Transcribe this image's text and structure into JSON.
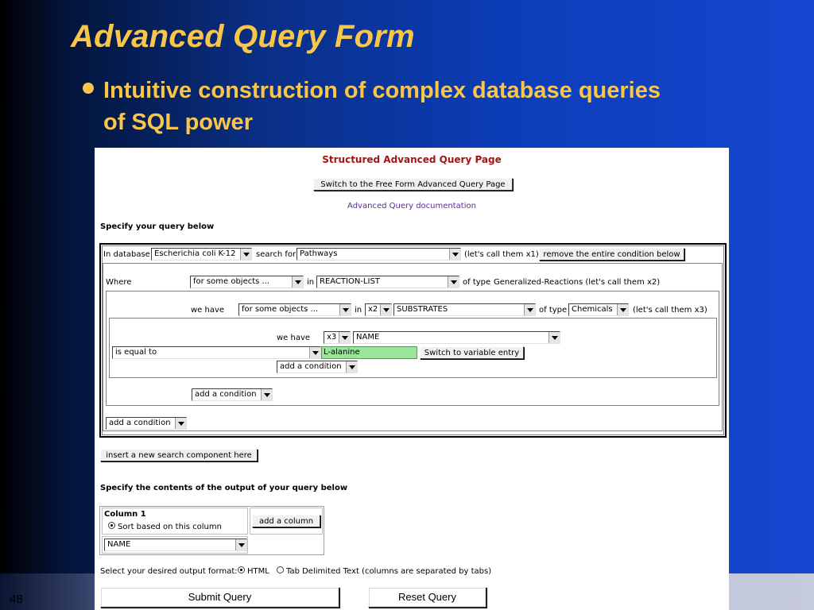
{
  "slide": {
    "title": "Advanced Query Form",
    "bullet": "Intuitive construction of complex database queries of SQL power",
    "page_number": "48",
    "colors": {
      "title": "#f7c64a",
      "background": "#0c3db8",
      "panel": "#ffffff"
    }
  },
  "query_page": {
    "heading": "Structured Advanced Query Page",
    "switch_free_form_label": "Switch to the Free Form Advanced Query Page",
    "documentation_link": "Advanced Query documentation",
    "specify_query_label": "Specify your query below",
    "db_row": {
      "in_database_label": "In database",
      "database_value": "Escherichia coli K-12",
      "search_for_label": "search for",
      "search_for_value": "Pathways",
      "call_note": "(let's call them  x1)",
      "remove_button": "remove the entire condition below"
    },
    "where_row": {
      "where_label": "Where",
      "quantifier_value": "for some objects ...",
      "in_label": "in",
      "slot_value": "REACTION-LIST",
      "of_type_label": "of type",
      "type_text": "Generalized-Reactions (let's call them  x2)"
    },
    "have_row": {
      "we_have_label": "we have",
      "quantifier_value": "for some objects ...",
      "in_label": "in",
      "var_value": "x2",
      "slot_value": "SUBSTRATES",
      "of_type_label": "of type",
      "type_value": "Chemicals",
      "call_note": "(let's call them  x3)"
    },
    "inner_row": {
      "we_have_label": "we have",
      "var_value": "x3",
      "slot_value": "NAME",
      "operator_value": "is equal to",
      "value_text": "L-alanine",
      "switch_variable_button": "Switch to variable entry",
      "add_condition_value": "add a condition"
    },
    "add_condition_mid": "add a condition",
    "add_condition_outer": "add a condition",
    "insert_component_button": "insert a new search component here",
    "output_label": "Specify the contents of the output of your query below",
    "column": {
      "title": "Column 1",
      "sort_label": "Sort based on this column",
      "sort_selected": true,
      "field_value": "NAME",
      "add_column_button": "add a column"
    },
    "format": {
      "label": "Select your desired output format:",
      "options": [
        {
          "label": "HTML",
          "selected": true
        },
        {
          "label": "Tab Delimited Text (columns are separated by tabs)",
          "selected": false
        }
      ]
    },
    "submit_button": "Submit Query",
    "reset_button": "Reset Query"
  }
}
